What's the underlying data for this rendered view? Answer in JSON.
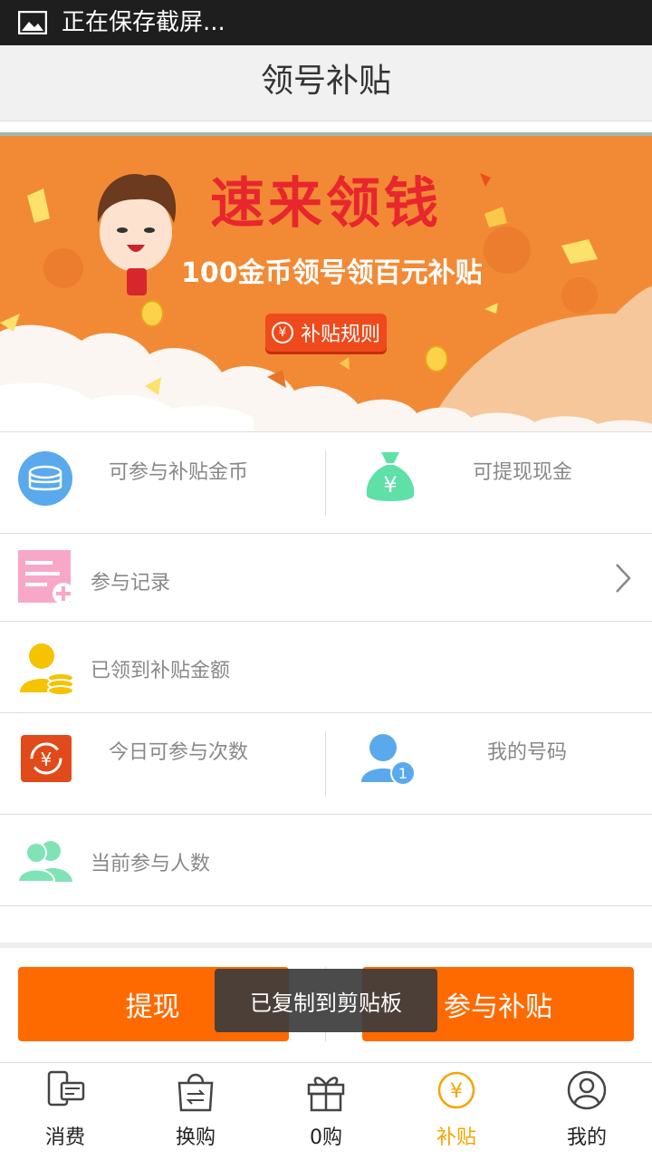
{
  "status_bar": {
    "text": "正在保存截屏...",
    "icon": "image-icon"
  },
  "header": {
    "title": "领号补贴"
  },
  "banner": {
    "title": "速来领钱",
    "subtitle": "100金币领号领百元补贴",
    "rules_button": "补贴规则",
    "bg_color": "#f28a35",
    "icons": [
      "mascot-boy",
      "coin-icon",
      "money-bill-icon"
    ]
  },
  "stats": {
    "coins_label": "可参与补贴金币",
    "cash_label": "可提现现金",
    "records_label": "参与记录",
    "received_label": "已领到补贴金额",
    "today_label": "今日可参与次数",
    "my_number_label": "我的号码",
    "participants_label": "当前参与人数"
  },
  "actions": {
    "withdraw": "提现",
    "join": "参与补贴",
    "accent": "#ff6a00"
  },
  "toast": {
    "text": "已复制到剪贴板"
  },
  "tabs": [
    {
      "label": "消费",
      "icon": "phone-card-icon"
    },
    {
      "label": "换购",
      "icon": "shopping-bag-icon"
    },
    {
      "label": "0购",
      "icon": "gift-icon"
    },
    {
      "label": "补贴",
      "icon": "yen-coin-icon",
      "active": true
    },
    {
      "label": "我的",
      "icon": "user-icon"
    }
  ]
}
